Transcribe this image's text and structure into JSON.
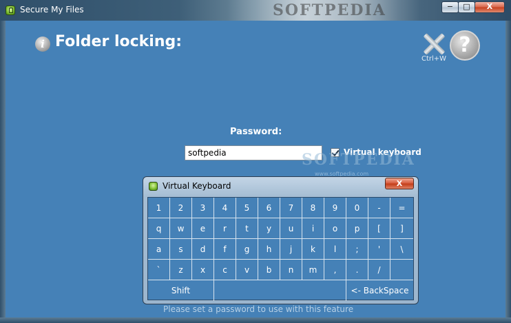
{
  "window": {
    "title": "Secure My Files",
    "watermark": "SOFTPEDIA",
    "buttons": {
      "minimize": "−",
      "maximize": "□",
      "close": "X"
    }
  },
  "header": {
    "title": "Folder locking:",
    "close_shortcut": "Ctrl+W",
    "help_glyph": "?",
    "info_glyph": "i"
  },
  "form": {
    "password_label": "Password:",
    "password_value": "softpedia",
    "virtual_keyboard_label": "Virtual keyboard",
    "virtual_keyboard_checked": true
  },
  "watermark": {
    "text": "SOFTPEDIA",
    "url": "www.softpedia.com"
  },
  "status": "Please set a password to use with this feature",
  "virtual_keyboard": {
    "title": "Virtual Keyboard",
    "close_label": "X",
    "rows": [
      [
        "1",
        "2",
        "3",
        "4",
        "5",
        "6",
        "7",
        "8",
        "9",
        "0",
        "-",
        "="
      ],
      [
        "q",
        "w",
        "e",
        "r",
        "t",
        "y",
        "u",
        "i",
        "o",
        "p",
        "[",
        "]"
      ],
      [
        "a",
        "s",
        "d",
        "f",
        "g",
        "h",
        "j",
        "k",
        "l",
        ";",
        "'",
        "\\"
      ],
      [
        "`",
        "z",
        "x",
        "c",
        "v",
        "b",
        "n",
        "m",
        ",",
        ".",
        "/",
        ""
      ]
    ],
    "shift_label": "Shift",
    "backspace_label": "<-  BackSpace"
  },
  "icons": [
    "app-icon",
    "info-icon",
    "close-icon",
    "help-icon",
    "checkbox-check-icon"
  ]
}
